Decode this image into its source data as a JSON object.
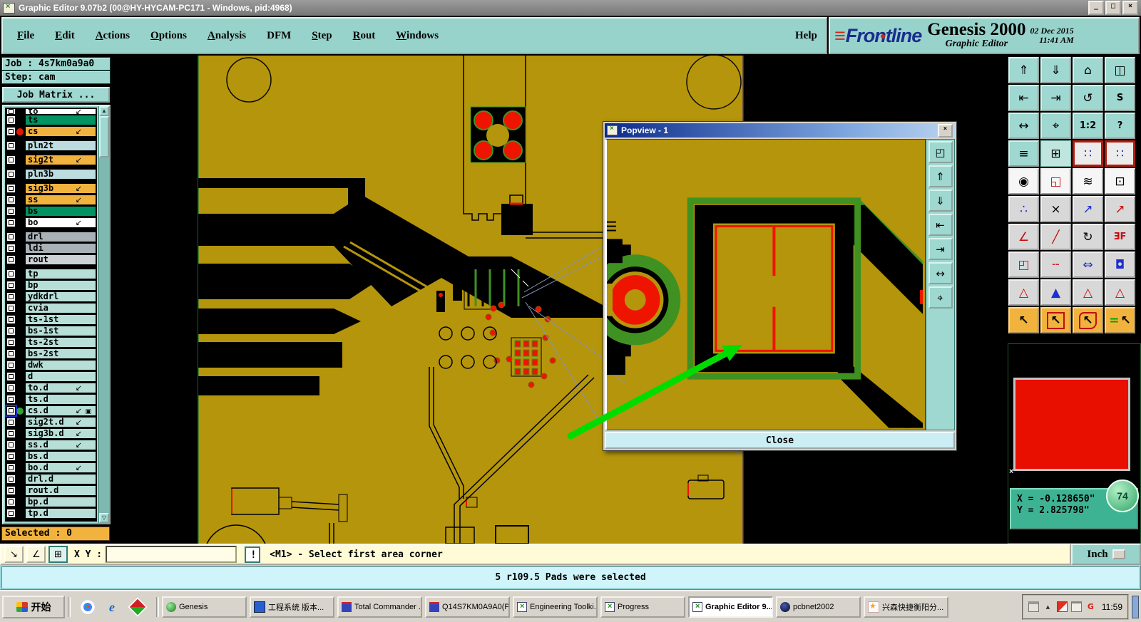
{
  "colors": {
    "copper": "#B5950B",
    "outline_green": "#3F9222",
    "selection_red": "#EE1400",
    "arrow_green": "#00DC00",
    "ui_teal": "#98D3CB",
    "panel_teal": "#9ED8D0",
    "coord_teal": "#3EB394",
    "selected_orange": "#F2B33E",
    "message_cyan": "#CFF4FA",
    "status_cream": "#FFFBD6"
  },
  "window": {
    "title": "Graphic Editor 9.07b2 (00@HY-HYCAM-PC171 - Windows, pid:4968)",
    "minimize": "_",
    "maximize": "□",
    "close": "×"
  },
  "menubar": {
    "items": [
      {
        "label": "File",
        "u": "1"
      },
      {
        "label": "Edit",
        "u": "1"
      },
      {
        "label": "Actions",
        "u": "1"
      },
      {
        "label": "Options",
        "u": "1"
      },
      {
        "label": "Analysis",
        "u": "1"
      },
      {
        "label": "DFM"
      },
      {
        "label": "Step",
        "u": "1"
      },
      {
        "label": "Rout",
        "u": "1"
      },
      {
        "label": "Windows",
        "u": "1"
      }
    ],
    "help": "Help"
  },
  "brand": {
    "logo": "Frontline",
    "product": "Genesis 2000",
    "date": "02 Dec 2015",
    "time": "11:41 AM",
    "subtitle": "Graphic Editor"
  },
  "sidebar": {
    "job": "Job : 4s7km0a9a0",
    "step": "Step: cam",
    "job_matrix": "Job Matrix ...",
    "selected": "Selected : 0",
    "layers": [
      {
        "name": "to",
        "color": "white",
        "arrow": "↙",
        "cut": "1"
      },
      {
        "name": "ts",
        "color": "green"
      },
      {
        "name": "cs",
        "color": "orange",
        "dot": "red",
        "arrow": "↙"
      },
      {
        "name": "pln2t",
        "color": "blue",
        "gap": "1"
      },
      {
        "name": "sig2t",
        "color": "orange",
        "arrow": "↙",
        "gap": "1"
      },
      {
        "name": "pln3b",
        "color": "blue",
        "gap": "1"
      },
      {
        "name": "sig3b",
        "color": "orange",
        "arrow": "↙",
        "gap": "1"
      },
      {
        "name": "ss",
        "color": "orange",
        "arrow": "↙"
      },
      {
        "name": "bs",
        "color": "green"
      },
      {
        "name": "bo",
        "color": "white",
        "arrow": "↙"
      },
      {
        "name": "drl",
        "color": "gray",
        "gap": "1"
      },
      {
        "name": "ldi",
        "color": "gray"
      },
      {
        "name": "rout",
        "color": "gray2"
      },
      {
        "name": "tp",
        "color": "teal",
        "gap": "1"
      },
      {
        "name": "bp",
        "color": "teal"
      },
      {
        "name": "ydkdrl",
        "color": "teal"
      },
      {
        "name": "cvia",
        "color": "teal"
      },
      {
        "name": "ts-1st",
        "color": "teal"
      },
      {
        "name": "bs-1st",
        "color": "teal"
      },
      {
        "name": "ts-2st",
        "color": "teal"
      },
      {
        "name": "bs-2st",
        "color": "teal"
      },
      {
        "name": "dwk",
        "color": "teal"
      },
      {
        "name": "d",
        "color": "teal"
      },
      {
        "name": "to.d",
        "color": "teal",
        "arrow": "↙"
      },
      {
        "name": "ts.d",
        "color": "teal"
      },
      {
        "name": "cs.d",
        "color": "teal",
        "dot": "green",
        "arrow": "↙",
        "extra": "▣",
        "cb": "blue"
      },
      {
        "name": "sig2t.d",
        "color": "teal",
        "arrow": "↙"
      },
      {
        "name": "sig3b.d",
        "color": "teal",
        "arrow": "↙"
      },
      {
        "name": "ss.d",
        "color": "teal",
        "arrow": "↙"
      },
      {
        "name": "bs.d",
        "color": "teal"
      },
      {
        "name": "bo.d",
        "color": "teal",
        "arrow": "↙"
      },
      {
        "name": "drl.d",
        "color": "teal"
      },
      {
        "name": "rout.d",
        "color": "teal"
      },
      {
        "name": "bp.d",
        "color": "teal"
      },
      {
        "name": "tp.d",
        "color": "teal"
      }
    ]
  },
  "popview": {
    "title": "Popview - 1",
    "close_x": "×",
    "close_button": "Close",
    "buttons": [
      {
        "g": "◰",
        "n": "popview-duplicate-button"
      },
      {
        "g": "⇑",
        "n": "popview-zoom-in-button"
      },
      {
        "g": "⇓",
        "n": "popview-zoom-out-button"
      },
      {
        "g": "⇤",
        "n": "popview-previous-view-button"
      },
      {
        "g": "⇥",
        "n": "popview-next-view-button"
      },
      {
        "g": "↔",
        "n": "popview-fit-button"
      },
      {
        "g": "⌖",
        "n": "popview-center-button"
      }
    ]
  },
  "toolbar_right": {
    "buttons": [
      {
        "g": "⇑",
        "n": "zoom-in-button",
        "sec": "teal"
      },
      {
        "g": "⇓",
        "n": "zoom-out-button",
        "sec": "teal"
      },
      {
        "g": "⌂",
        "n": "home-view-button",
        "sec": "teal"
      },
      {
        "g": "◫",
        "n": "split-window-button",
        "sec": "teal"
      },
      {
        "g": "⇤",
        "n": "previous-view-button",
        "sec": "teal"
      },
      {
        "g": "⇥",
        "n": "next-view-button",
        "sec": "teal"
      },
      {
        "g": "↺",
        "n": "undo-view-button",
        "sec": "teal"
      },
      {
        "g": "S",
        "n": "s-view-button",
        "sec": "teal",
        "small": "1"
      },
      {
        "g": "↔",
        "n": "fit-view-button",
        "sec": "teal"
      },
      {
        "g": "⌖",
        "n": "center-view-button",
        "sec": "teal"
      },
      {
        "g": "1:2",
        "n": "zoom-scale-button",
        "sec": "teal",
        "small": "1"
      },
      {
        "g": "?",
        "n": "context-help-button",
        "sec": "teal",
        "small": "1"
      },
      {
        "g": "≡",
        "n": "setup-tools-button",
        "sec": "teal"
      },
      {
        "g": "⊞",
        "n": "grid-settings-button",
        "sec": "tealflat"
      },
      {
        "g": "∷",
        "n": "netlist-front-button",
        "sec": "rednet"
      },
      {
        "g": "∷",
        "n": "netlist-back-button",
        "sec": "rednet"
      },
      {
        "g": "◉",
        "n": "move-pad-button",
        "sec": "white"
      },
      {
        "g": "◱",
        "n": "copy-shape-button",
        "sec": "white",
        "c": "red"
      },
      {
        "g": "≋",
        "n": "measure-ruler-button",
        "sec": "white"
      },
      {
        "g": "⊡",
        "n": "select-pad-button",
        "sec": "white"
      },
      {
        "g": "∴",
        "n": "chain-select-button",
        "sec": "gray",
        "c": "blue"
      },
      {
        "g": "×",
        "n": "delete-button",
        "sec": "gray"
      },
      {
        "g": "↗",
        "n": "copy-to-layer-button",
        "sec": "gray",
        "c": "blue"
      },
      {
        "g": "↗",
        "n": "move-to-layer-button",
        "sec": "gray",
        "c": "red"
      },
      {
        "g": "∠",
        "n": "measure-angle-button",
        "sec": "gray",
        "c": "red"
      },
      {
        "g": "╱",
        "n": "measure-distance-button",
        "sec": "gray",
        "c": "red"
      },
      {
        "g": "↻",
        "n": "rotate-button",
        "sec": "gray"
      },
      {
        "g": "ƎF",
        "n": "mirror-button",
        "sec": "gray",
        "c": "red",
        "small": "1"
      },
      {
        "g": "◰",
        "n": "copy-pad-button",
        "sec": "gray",
        "c": "red"
      },
      {
        "g": "╌",
        "n": "break-segment-button",
        "sec": "gray",
        "c": "red"
      },
      {
        "g": "⇔",
        "n": "stretch-button",
        "sec": "gray",
        "c": "blue"
      },
      {
        "g": "◘",
        "n": "merge-shapes-button",
        "sec": "gray",
        "c": "blue"
      },
      {
        "g": "△",
        "n": "thermal-open-button",
        "sec": "gray",
        "c": "red"
      },
      {
        "g": "▲",
        "n": "thermal-filled-button",
        "sec": "gray",
        "c": "blue"
      },
      {
        "g": "△",
        "n": "thermal-cross-button",
        "sec": "gray",
        "c": "red"
      },
      {
        "g": "△",
        "n": "thermal-width-button",
        "sec": "gray",
        "c": "red"
      },
      {
        "g": "↖",
        "n": "select-single-button",
        "sec": "orange"
      },
      {
        "g": "↖",
        "n": "select-frame-button",
        "sec": "orange",
        "v": "frame"
      },
      {
        "g": "↖",
        "n": "select-poly-button",
        "sec": "orange",
        "v": "poly"
      },
      {
        "g": "↖",
        "n": "select-net-button",
        "sec": "orange",
        "v": "net"
      }
    ]
  },
  "overview": {
    "x_coord": "X = -0.128650\"",
    "y_coord": "Y = 2.825798\"",
    "badge": "74"
  },
  "statusbar": {
    "tools": [
      {
        "g": "↘",
        "n": "pointer-snap-button"
      },
      {
        "g": "∠",
        "n": "angle-snap-button"
      },
      {
        "g": "⊞",
        "n": "grid-window-button",
        "teal": "1"
      }
    ],
    "xy_label": "X Y :",
    "input_value": "",
    "alert": "!",
    "prompt": "<M1> - Select first area corner",
    "unit": "Inch"
  },
  "message_bar": "5 r109.5 Pads were selected",
  "taskbar": {
    "start": "开始",
    "quicklaunch": [
      {
        "name": "chrome-icon",
        "kind": "chrome"
      },
      {
        "name": "ie-icon",
        "kind": "ie",
        "g": "e"
      },
      {
        "name": "app-quicklaunch-icon",
        "kind": "nid"
      }
    ],
    "tasks": [
      {
        "label": "Genesis",
        "kind": "genesis"
      },
      {
        "label": "工程系统 版本...",
        "kind": "appblue"
      },
      {
        "label": "Total Commander ...",
        "kind": "floppy"
      },
      {
        "label": "Q14S7KM0A9A0(P...",
        "kind": "floppy"
      },
      {
        "label": "Engineering Toolki...",
        "kind": "xapp"
      },
      {
        "label": "Progress",
        "kind": "xapp"
      },
      {
        "label": "Graphic Editor 9....",
        "kind": "xapp",
        "active": "1"
      },
      {
        "label": "pcbnet2002",
        "kind": "globe"
      },
      {
        "label": "兴森快捷衡阳分...",
        "kind": "star"
      }
    ],
    "tray": [
      {
        "name": "printer-tray-icon",
        "kind": "printer"
      },
      {
        "name": "language-tray-icon",
        "kind": "caret",
        "g": "▴"
      },
      {
        "name": "app-tray-icon",
        "kind": "redblue"
      },
      {
        "name": "clipboard-tray-icon",
        "kind": "clip"
      },
      {
        "name": "sogou-tray-icon",
        "kind": "g",
        "g": "G"
      }
    ],
    "clock": "11:59"
  }
}
